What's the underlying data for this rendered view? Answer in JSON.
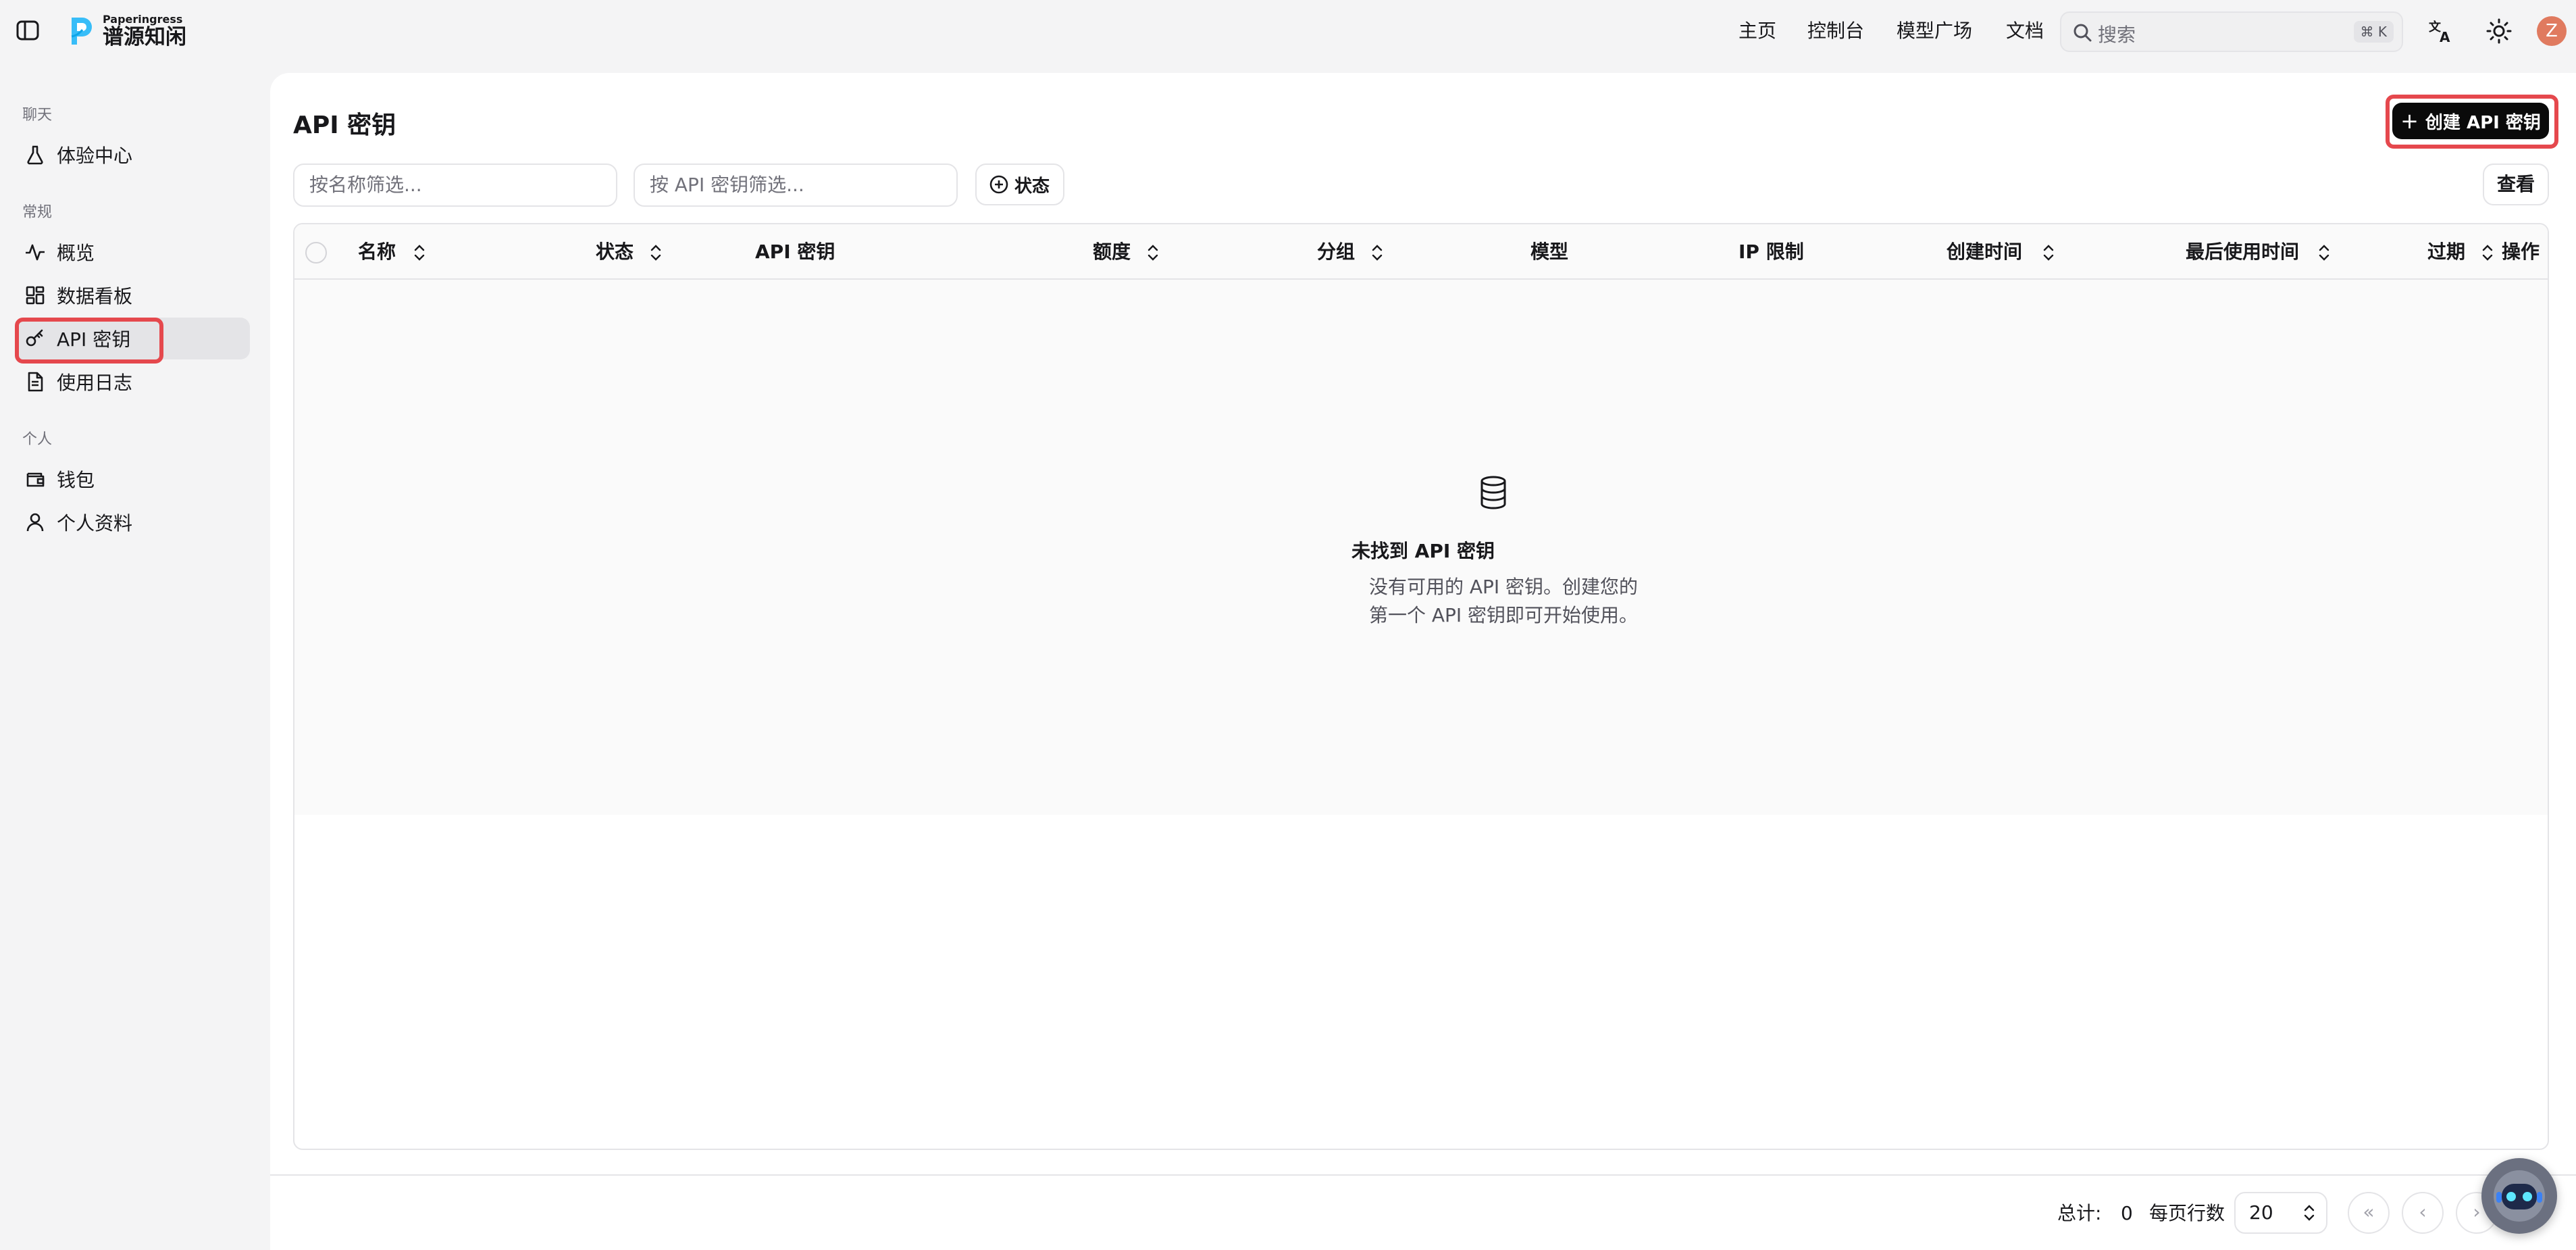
{
  "brand": {
    "name_en": "Paperingress",
    "name_cn": "谱源知闲"
  },
  "topnav": {
    "items": [
      {
        "label": "主页"
      },
      {
        "label": "控制台"
      },
      {
        "label": "模型广场"
      },
      {
        "label": "文档"
      }
    ],
    "search": {
      "placeholder": "搜索",
      "shortcut": "⌘ K"
    },
    "avatar_initial": "Z"
  },
  "sidebar": {
    "groups": [
      {
        "label": "聊天",
        "items": [
          {
            "label": "体验中心",
            "icon": "flask-icon"
          }
        ]
      },
      {
        "label": "常规",
        "items": [
          {
            "label": "概览",
            "icon": "activity-icon"
          },
          {
            "label": "数据看板",
            "icon": "dashboard-icon"
          },
          {
            "label": "API 密钥",
            "icon": "key-icon",
            "active": true
          },
          {
            "label": "使用日志",
            "icon": "file-text-icon"
          }
        ]
      },
      {
        "label": "个人",
        "items": [
          {
            "label": "钱包",
            "icon": "wallet-icon"
          },
          {
            "label": "个人资料",
            "icon": "user-icon"
          }
        ]
      }
    ]
  },
  "main": {
    "title": "API 密钥",
    "create_button": "创建 API 密钥",
    "filters": {
      "name_placeholder": "按名称筛选...",
      "key_placeholder": "按 API 密钥筛选...",
      "status_label": "状态",
      "view_label": "查看"
    },
    "table": {
      "columns": [
        {
          "label": "名称",
          "sortable": true
        },
        {
          "label": "状态",
          "sortable": true
        },
        {
          "label": "API 密钥",
          "sortable": false
        },
        {
          "label": "额度",
          "sortable": true
        },
        {
          "label": "分组",
          "sortable": true
        },
        {
          "label": "模型",
          "sortable": false
        },
        {
          "label": "IP 限制",
          "sortable": false
        },
        {
          "label": "创建时间",
          "sortable": true
        },
        {
          "label": "最后使用时间",
          "sortable": true
        },
        {
          "label": "过期",
          "sortable": true
        },
        {
          "label": "操作",
          "sortable": false
        }
      ],
      "rows": [],
      "empty": {
        "title": "未找到 API 密钥",
        "desc_line1": "没有可用的 API 密钥。创建您的",
        "desc_line2": "第一个 API 密钥即可开始使用。"
      }
    },
    "pagination": {
      "total_label": "总计:",
      "total": "0",
      "rows_per_page_label": "每页行数",
      "rows_per_page": "20"
    }
  },
  "colors": {
    "accent": "#0a0a0a",
    "highlight": "#e5484d",
    "avatar": "#e07a5f"
  }
}
